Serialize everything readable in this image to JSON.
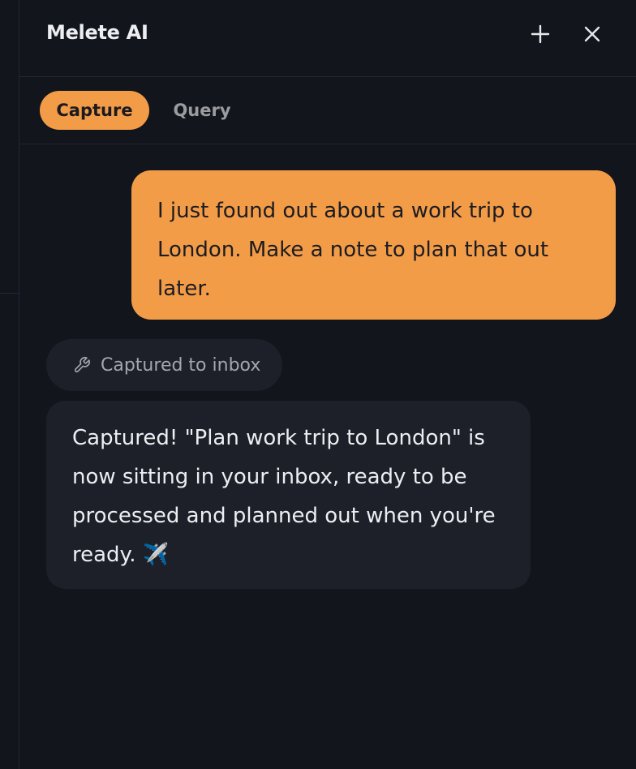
{
  "header": {
    "title": "Melete AI",
    "new_icon": "plus-icon",
    "close_icon": "close-icon"
  },
  "tabs": [
    {
      "label": "Capture",
      "active": true
    },
    {
      "label": "Query",
      "active": false
    }
  ],
  "conversation": {
    "user_message": "I just found out about a work trip to London. Make a note to plan that out later.",
    "tool_status": {
      "icon": "wrench-icon",
      "label": "Captured to inbox"
    },
    "assistant_message": "Captured! \"Plan work trip to London\" is now sitting in your inbox, ready to be processed and planned out when you're ready. ✈️"
  },
  "colors": {
    "accent": "#f39c48",
    "background": "#13151c",
    "bubble": "#1d2029",
    "divider": "#232733"
  }
}
